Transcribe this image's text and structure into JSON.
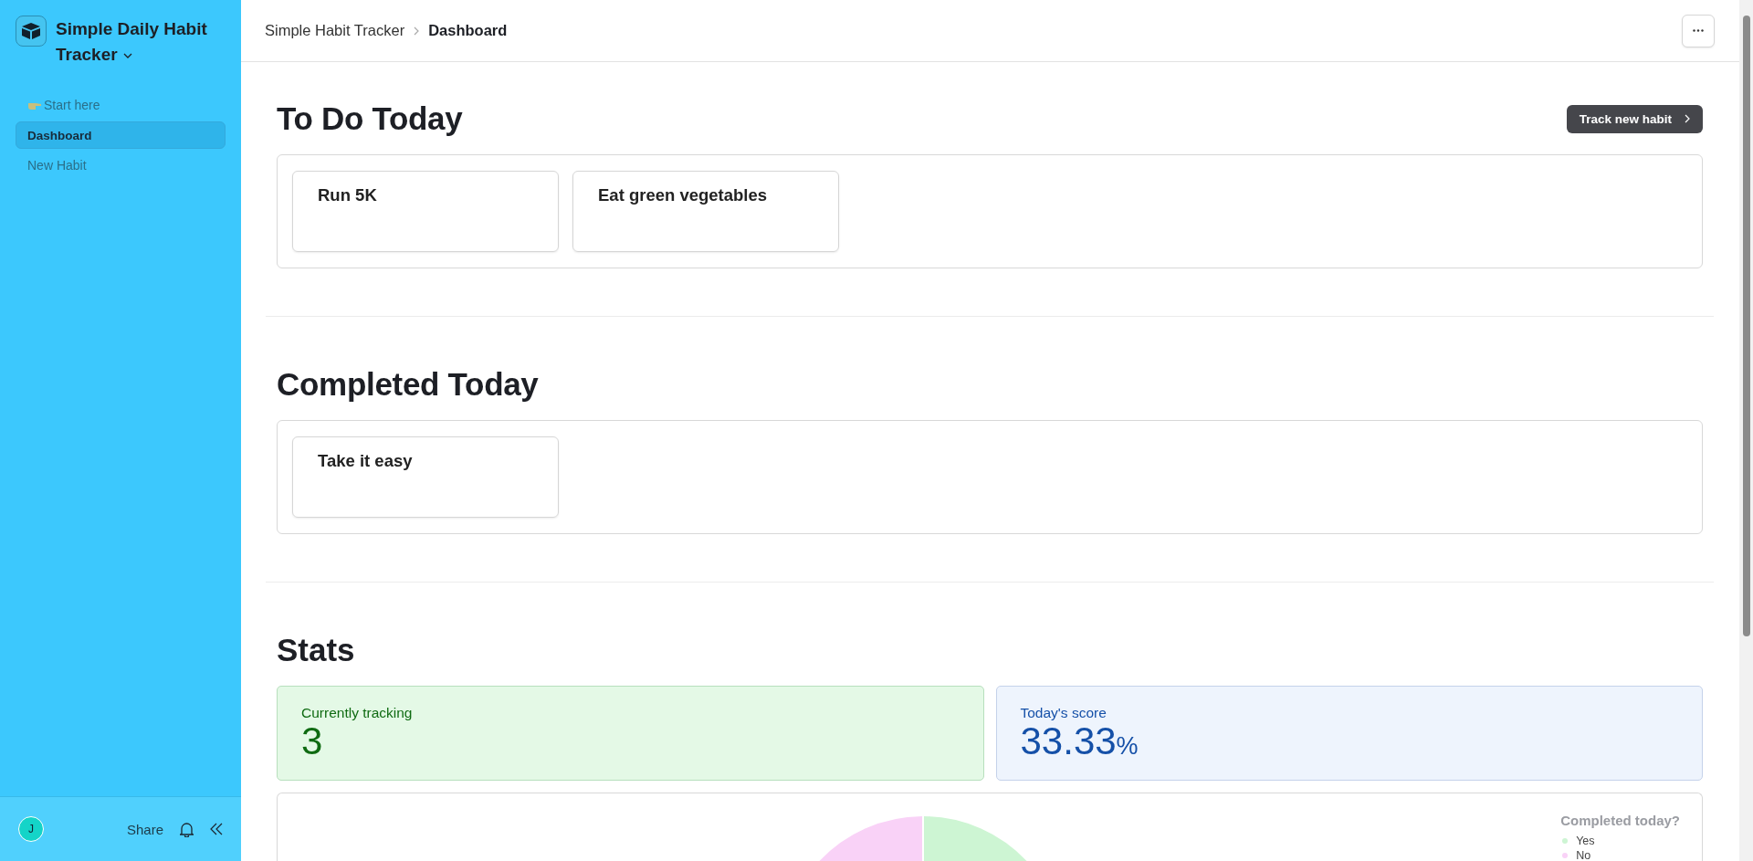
{
  "sidebar": {
    "app_title": "Simple Daily Habit Tracker",
    "nav": [
      {
        "label": "Start here",
        "kind": "guide",
        "selected": false
      },
      {
        "label": "Dashboard",
        "kind": "page",
        "selected": true
      },
      {
        "label": "New Habit",
        "kind": "page",
        "selected": false
      }
    ],
    "footer": {
      "avatar": "J",
      "share": "Share"
    }
  },
  "header": {
    "breadcrumb": [
      "Simple Habit Tracker",
      "Dashboard"
    ]
  },
  "sections": [
    {
      "title": "To Do Today",
      "action": "Track new habit",
      "cards": [
        "Run 5K",
        "Eat green vegetables"
      ]
    },
    {
      "title": "Completed Today",
      "cards": [
        "Take it easy"
      ]
    }
  ],
  "stats": {
    "title": "Stats",
    "cards": [
      {
        "label": "Currently tracking",
        "value": "3",
        "kind": "count"
      },
      {
        "label": "Today's score",
        "value": "33.33",
        "unit": "%",
        "kind": "percent"
      }
    ],
    "chart": {
      "legend_title": "Completed today?",
      "legend": [
        {
          "label": "Yes",
          "color": "#cdf5d3"
        },
        {
          "label": "No",
          "color": "#f9d2f7"
        }
      ]
    }
  }
}
